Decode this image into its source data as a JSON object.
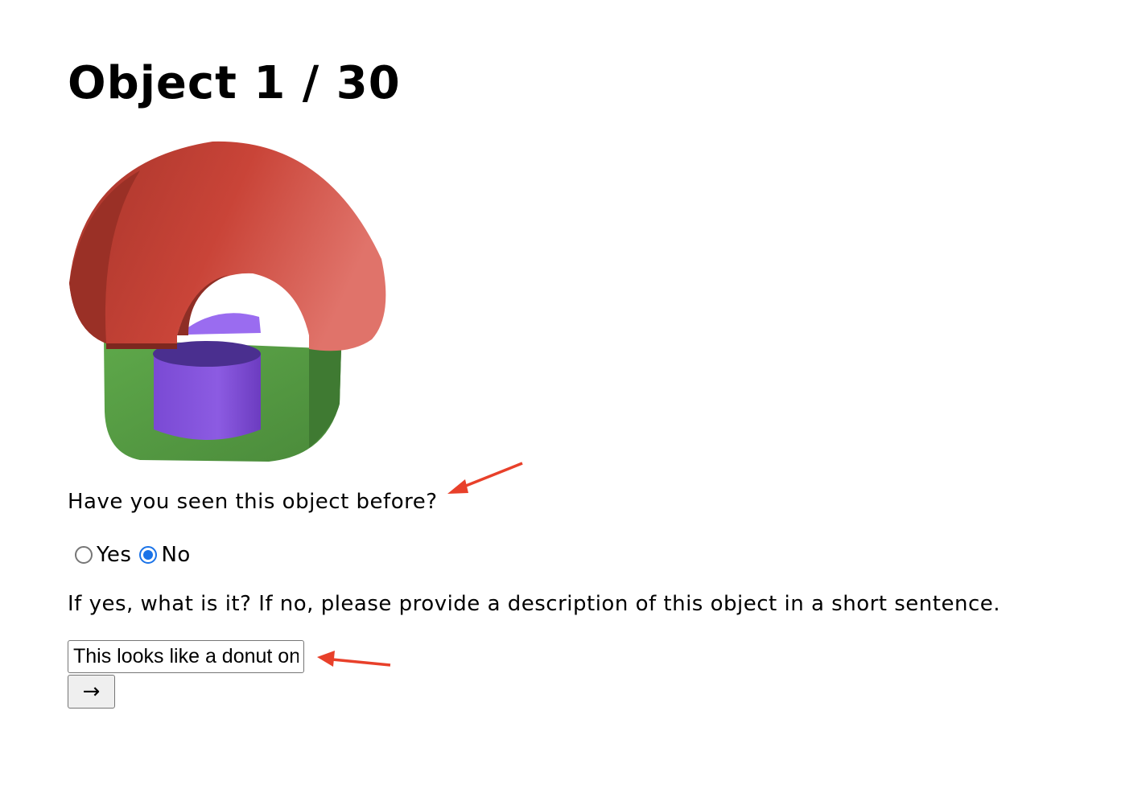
{
  "header": {
    "title": "Object 1 / 30"
  },
  "question": {
    "text": "Have you seen this object before?",
    "options": [
      {
        "label": "Yes",
        "checked": false
      },
      {
        "label": "No",
        "checked": true
      }
    ]
  },
  "description": {
    "prompt": "If yes, what is it? If no, please provide a description of this object in a short sentence.",
    "value": "This looks like a donut on top of a cylinder"
  },
  "next_button": {
    "label": "→"
  },
  "colors": {
    "object_red": "#c9463a",
    "object_green": "#5fa14a",
    "object_purple": "#8a56de",
    "radio_checked": "#1a73e8",
    "annotation_arrow": "#e8402a"
  }
}
